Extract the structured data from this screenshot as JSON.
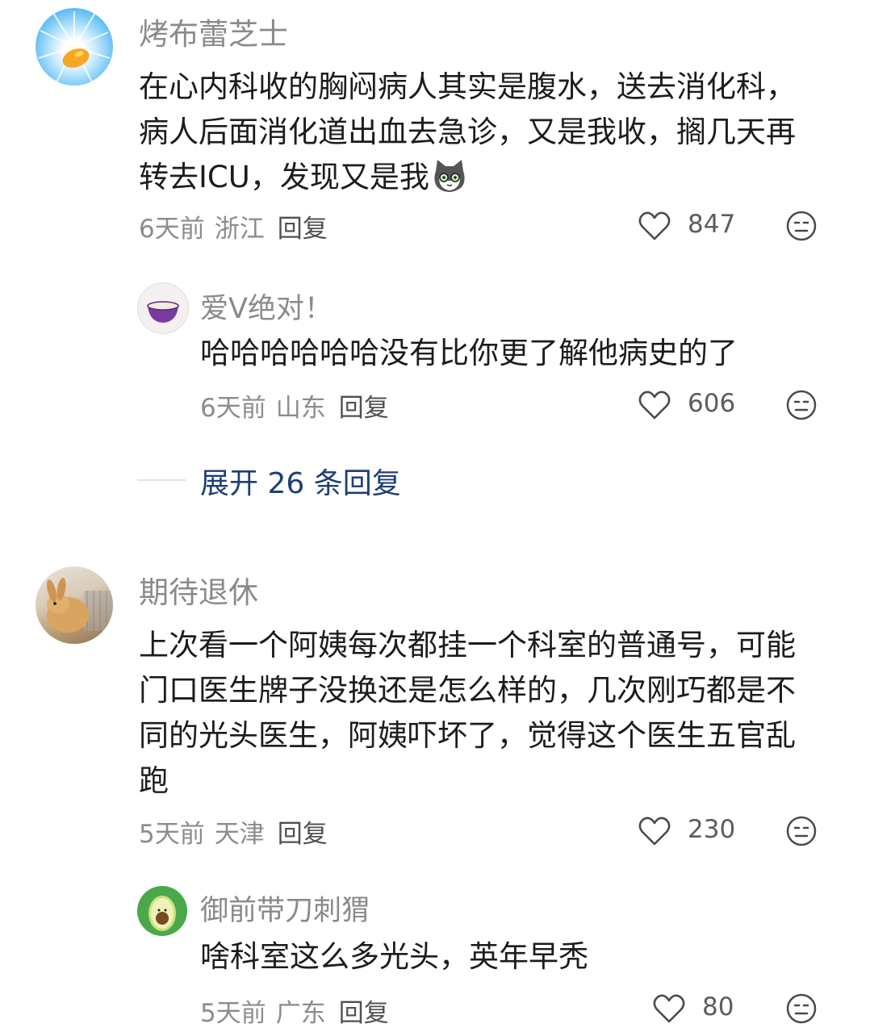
{
  "comments": [
    {
      "user": "烤布蕾芝士",
      "text": "在心内科收的胸闷病人其实是腹水，送去消化科，病人后面消化道出血去急诊，又是我收，搁几天再转去ICU，发现又是我",
      "time": "6天前",
      "region": "浙江",
      "reply_label": "回复",
      "likes": "847",
      "avatar_icon": "sun-mango-avatar",
      "emoji_icon": "cat-emoji-icon",
      "replies": [
        {
          "user": "爱V绝对！",
          "text": "哈哈哈哈哈哈没有比你更了解他病史的了",
          "time": "6天前",
          "region": "山东",
          "reply_label": "回复",
          "likes": "606",
          "avatar_icon": "purple-bowl-avatar"
        }
      ],
      "expand_label": "展开 26 条回复"
    },
    {
      "user": "期待退休",
      "text": "上次看一个阿姨每次都挂一个科室的普通号，可能门口医生牌子没换还是怎么样的，几次刚巧都是不同的光头医生，阿姨吓坏了，觉得这个医生五官乱跑",
      "time": "5天前",
      "region": "天津",
      "reply_label": "回复",
      "likes": "230",
      "avatar_icon": "rabbit-photo-avatar",
      "replies": [
        {
          "user": "御前带刀刺猬",
          "text": "啥科室这么多光头，英年早秃",
          "time": "5天前",
          "region": "广东",
          "reply_label": "回复",
          "likes": "80",
          "avatar_icon": "avocado-avatar"
        }
      ]
    }
  ],
  "colors": {
    "name": "#8a8a8a",
    "text": "#1c1c1c",
    "meta": "#8c8c8c",
    "expand": "#1d3f73"
  }
}
